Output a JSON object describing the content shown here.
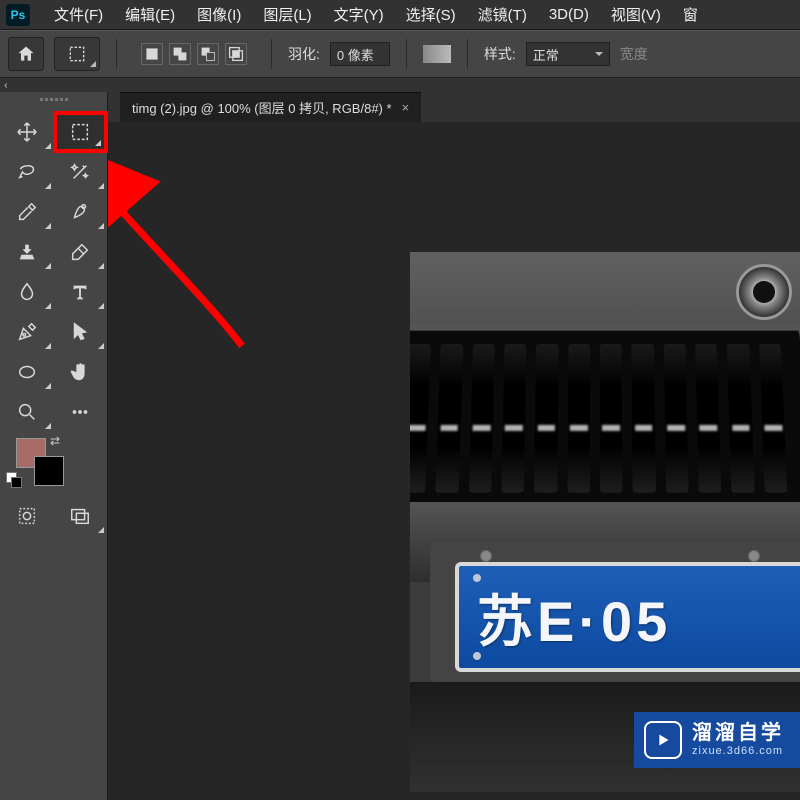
{
  "menu": {
    "items": [
      "文件(F)",
      "编辑(E)",
      "图像(I)",
      "图层(L)",
      "文字(Y)",
      "选择(S)",
      "滤镜(T)",
      "3D(D)",
      "视图(V)",
      "窗"
    ]
  },
  "options": {
    "feather_label": "羽化:",
    "feather_value": "0 像素",
    "style_label": "样式:",
    "style_value": "正常",
    "width_label": "宽度"
  },
  "document": {
    "tab_title": "timg (2).jpg @ 100% (图层 0 拷贝, RGB/8#) *"
  },
  "plate": {
    "text": "苏E·05"
  },
  "watermark": {
    "title": "溜溜自学",
    "url": "zixue.3d66.com"
  },
  "collapse_glyph": "‹‹"
}
